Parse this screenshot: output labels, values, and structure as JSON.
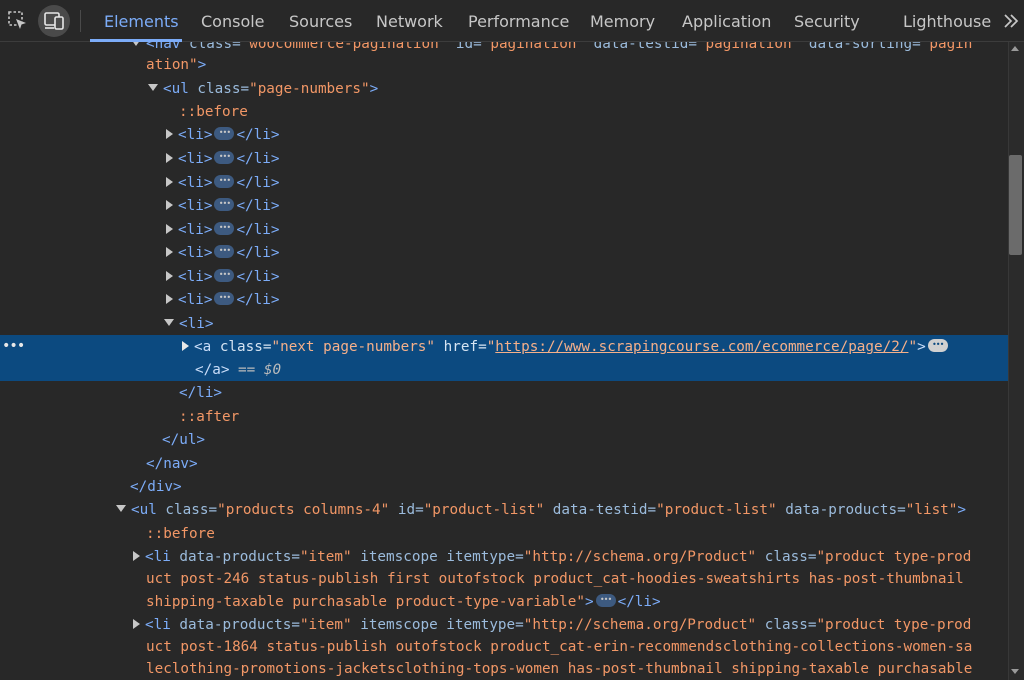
{
  "toolbar": {
    "tabs": [
      {
        "label": "Elements",
        "active": true
      },
      {
        "label": "Console"
      },
      {
        "label": "Sources"
      },
      {
        "label": "Network"
      },
      {
        "label": "Performance"
      },
      {
        "label": "Memory"
      },
      {
        "label": "Application"
      },
      {
        "label": "Security"
      },
      {
        "label": "Lighthouse"
      }
    ],
    "icons": [
      "inspect-element-icon",
      "device-toolbar-icon",
      "more-tabs-chevron-icon"
    ]
  },
  "tree": {
    "nav_line1": {
      "open": "<nav",
      "a1": " class=",
      "v1": "\"woocommerce-pagination\"",
      "a2": " id=",
      "v2": "\"pagination\"",
      "a3": " data-testid=",
      "v3": "\"pagination\"",
      "a4": " data-sorting=",
      "v4": "\"pagin"
    },
    "nav_line2": {
      "v": "ation\"",
      "close": ">"
    },
    "ul_pages": {
      "open": "<ul",
      "a1": " class=",
      "v1": "\"page-numbers\"",
      "close": ">"
    },
    "before1": "::before",
    "li_collapsed": {
      "open": "<li>",
      "close": "</li>",
      "count": 8
    },
    "li_open": "<li>",
    "anchor": {
      "open": "<a",
      "a1": " class=",
      "v1": "\"next page-numbers\"",
      "a2": " href=",
      "q1": "\"",
      "href": "https://www.scrapingcourse.com/ecommerce/page/2/",
      "q2": "\"",
      "close": ">"
    },
    "anchor_close": {
      "tag": "</a>",
      "eq": " == ",
      "ref": "$0"
    },
    "li_close": "</li>",
    "after": "::after",
    "ul_close": "</ul>",
    "nav_close": "</nav>",
    "div_close": "</div>",
    "ul_products": {
      "open": "<ul",
      "a1": " class=",
      "v1": "\"products columns-4\"",
      "a2": " id=",
      "v2": "\"product-list\"",
      "a3": " data-testid=",
      "v3": "\"product-list\"",
      "a4": " data-products=",
      "v4": "\"list\"",
      "close": ">"
    },
    "before2": "::before",
    "item1": {
      "l1": {
        "open": "<li",
        "a1": " data-products=",
        "v1": "\"item\"",
        "a2": " itemscope itemtype=",
        "v2": "\"http://schema.org/Product\"",
        "a3": " class=",
        "v3": "\"product type-prod"
      },
      "l2": "uct post-246 status-publish first outofstock product_cat-hoodies-sweatshirts has-post-thumbnail",
      "l3": {
        "v": "shipping-taxable purchasable product-type-variable\"",
        "gt": ">",
        "close": "</li>"
      }
    },
    "item2": {
      "l1": {
        "open": "<li",
        "a1": " data-products=",
        "v1": "\"item\"",
        "a2": " itemscope itemtype=",
        "v2": "\"http://schema.org/Product\"",
        "a3": " class=",
        "v3": "\"product type-prod"
      },
      "l2": "uct post-1864 status-publish outofstock product_cat-erin-recommendsclothing-collections-women-sa",
      "l3": "leclothing-promotions-jacketsclothing-tops-women has-post-thumbnail shipping-taxable purchasable"
    }
  },
  "colors": {
    "background": "#282828",
    "tag": "#7cacf8",
    "attr_name": "#9bbbdc",
    "attr_value": "#f29766",
    "selected_row": "#0c4a80"
  }
}
